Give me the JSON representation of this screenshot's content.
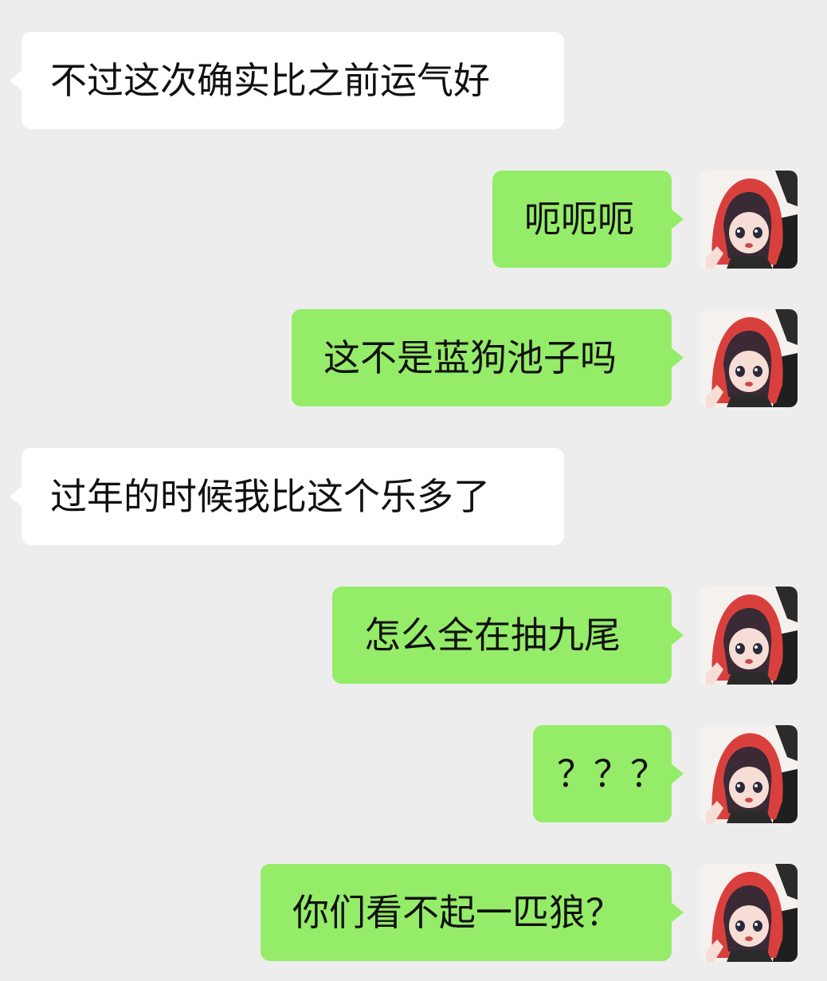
{
  "chat": {
    "messages": [
      {
        "side": "in",
        "text": "不过这次确实比之前运气好"
      },
      {
        "side": "out",
        "text": "呃呃呃"
      },
      {
        "side": "out",
        "text": "这不是蓝狗池子吗"
      },
      {
        "side": "in",
        "text": "过年的时候我比这个乐多了"
      },
      {
        "side": "out",
        "text": "怎么全在抽九尾"
      },
      {
        "side": "out",
        "text": "？？？"
      },
      {
        "side": "out",
        "text": "你们看不起一匹狼？"
      }
    ],
    "self_avatar_icon": "anime-girl-red-hood-avatar-icon",
    "colors": {
      "background": "#ededed",
      "incoming_bubble": "#ffffff",
      "outgoing_bubble": "#95ec69",
      "text": "#111111"
    }
  }
}
